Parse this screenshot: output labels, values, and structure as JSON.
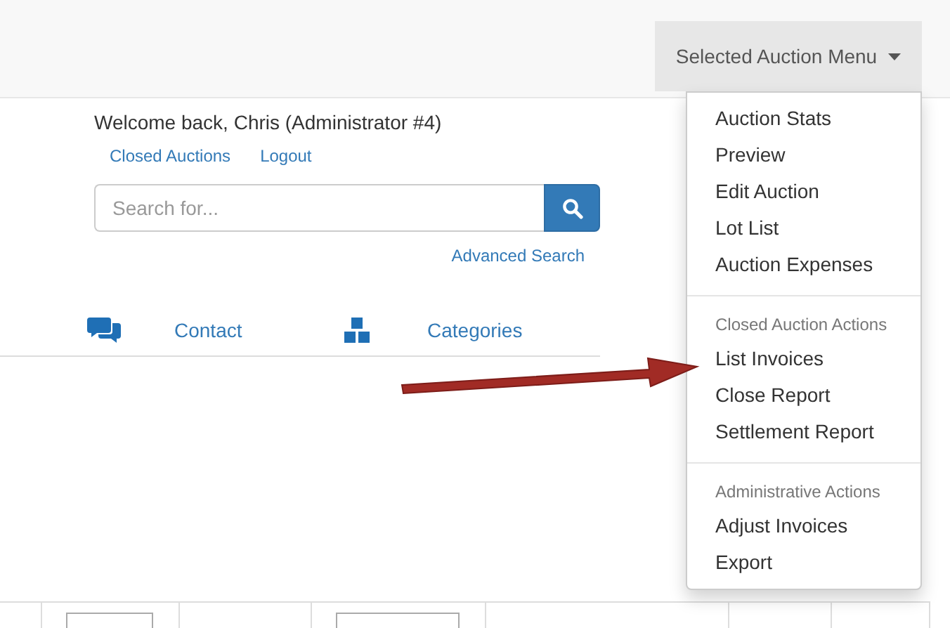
{
  "navbar": {
    "menu_button": "Selected Auction Menu"
  },
  "dropdown": {
    "sections": [
      {
        "items": [
          "Auction Stats",
          "Preview",
          "Edit Auction",
          "Lot List",
          "Auction Expenses"
        ]
      },
      {
        "header": "Closed Auction Actions",
        "items": [
          "List Invoices",
          "Close Report",
          "Settlement Report"
        ]
      },
      {
        "header": "Administrative Actions",
        "items": [
          "Adjust Invoices",
          "Export"
        ]
      }
    ]
  },
  "welcome": "Welcome back, Chris (Administrator #4)",
  "user_links": [
    "Closed Auctions",
    "Logout"
  ],
  "search": {
    "placeholder": "Search for..."
  },
  "advanced_search": "Advanced Search",
  "nav_tabs": [
    {
      "label": "Contact",
      "kind": "chat"
    },
    {
      "label": "Categories",
      "kind": "boxes"
    }
  ]
}
